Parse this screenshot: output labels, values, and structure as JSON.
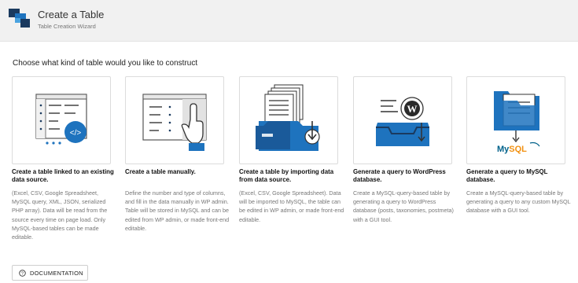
{
  "header": {
    "title": "Create a Table",
    "subtitle": "Table Creation Wizard",
    "logo_icon": "table-wizard-logo"
  },
  "main": {
    "heading": "Choose what kind of table would you like to construct"
  },
  "cards": [
    {
      "icon": "table-linked-datasource-icon",
      "title": "Create a table linked to an existing data source.",
      "description": "(Excel, CSV, Google Spreadsheet, MySQL query, XML, JSON, serialized PHP array). Data will be read from the source every time on page load. Only MySQL-based tables can be made editable."
    },
    {
      "icon": "table-manual-icon",
      "title": "Create a table manually.",
      "description": "Define the number and type of columns, and fill in the data manually in WP admin. Table will be stored in MySQL and can be edited from WP admin, or made front-end editable."
    },
    {
      "icon": "import-data-icon",
      "title": "Create a table by importing data from data source.",
      "description": "(Excel, CSV, Google Spreadsheet). Data will be imported to MySQL, the table can be edited in WP admin, or made front-end editable."
    },
    {
      "icon": "wordpress-query-icon",
      "title": "Generate a query to WordPress database.",
      "description": "Create a MySQL-query-based table by generating a query to WordPress database (posts, taxonomies, postmeta) with a GUI tool."
    },
    {
      "icon": "mysql-query-icon",
      "title": "Generate a query to MySQL database.",
      "description": "Create a MySQL-query-based table by generating a query to any custom MySQL database with a GUI tool.",
      "logo_text": "MySQL"
    }
  ],
  "footer": {
    "documentation_label": "DOCUMENTATION",
    "documentation_icon": "question-circle-icon"
  },
  "colors": {
    "brand_blue": "#1e73be",
    "dark_blue": "#1a3a5f",
    "mysql_orange": "#f29111",
    "header_bg": "#f1f1f1"
  }
}
